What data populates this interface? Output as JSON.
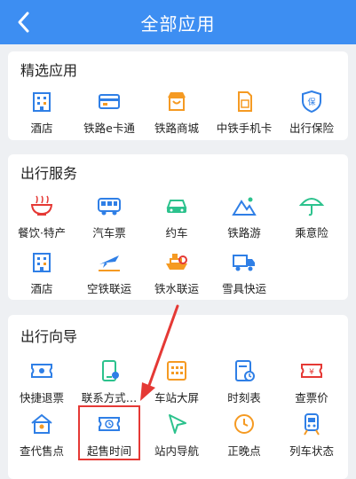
{
  "header": {
    "title": "全部应用",
    "back_icon": "back-arrow-icon"
  },
  "sections": [
    {
      "title": "精选应用",
      "items": [
        {
          "label": "酒店",
          "icon": "hotel-icon"
        },
        {
          "label": "铁路e卡通",
          "icon": "card-icon"
        },
        {
          "label": "铁路商城",
          "icon": "shop-icon"
        },
        {
          "label": "中铁手机卡",
          "icon": "sim-icon"
        },
        {
          "label": "出行保险",
          "icon": "insurance-icon"
        }
      ]
    },
    {
      "title": "出行服务",
      "items": [
        {
          "label": "餐饮·特产",
          "icon": "food-icon"
        },
        {
          "label": "汽车票",
          "icon": "bus-icon"
        },
        {
          "label": "约车",
          "icon": "car-icon"
        },
        {
          "label": "铁路游",
          "icon": "mountain-icon"
        },
        {
          "label": "乘意险",
          "icon": "umbrella-icon"
        },
        {
          "label": "酒店",
          "icon": "hotel-icon"
        },
        {
          "label": "空铁联运",
          "icon": "plane-icon"
        },
        {
          "label": "铁水联运",
          "icon": "ship-icon"
        },
        {
          "label": "雪具快运",
          "icon": "truck-icon"
        }
      ]
    },
    {
      "title": "出行向导",
      "items": [
        {
          "label": "快捷退票",
          "icon": "refund-ticket-icon"
        },
        {
          "label": "联系方式…",
          "icon": "contact-phone-icon"
        },
        {
          "label": "车站大屏",
          "icon": "station-screen-icon"
        },
        {
          "label": "时刻表",
          "icon": "timetable-icon"
        },
        {
          "label": "查票价",
          "icon": "price-ticket-icon"
        },
        {
          "label": "查代售点",
          "icon": "agency-house-icon"
        },
        {
          "label": "起售时间",
          "icon": "sale-time-icon"
        },
        {
          "label": "站内导航",
          "icon": "navigation-arrow-icon"
        },
        {
          "label": "正晚点",
          "icon": "clock-icon"
        },
        {
          "label": "列车状态",
          "icon": "train-icon"
        }
      ]
    }
  ],
  "colors": {
    "header": "#3d8ef2",
    "blue": "#2f7fe6",
    "orange": "#f59a22",
    "green": "#2cc28d",
    "red": "#e53935"
  }
}
